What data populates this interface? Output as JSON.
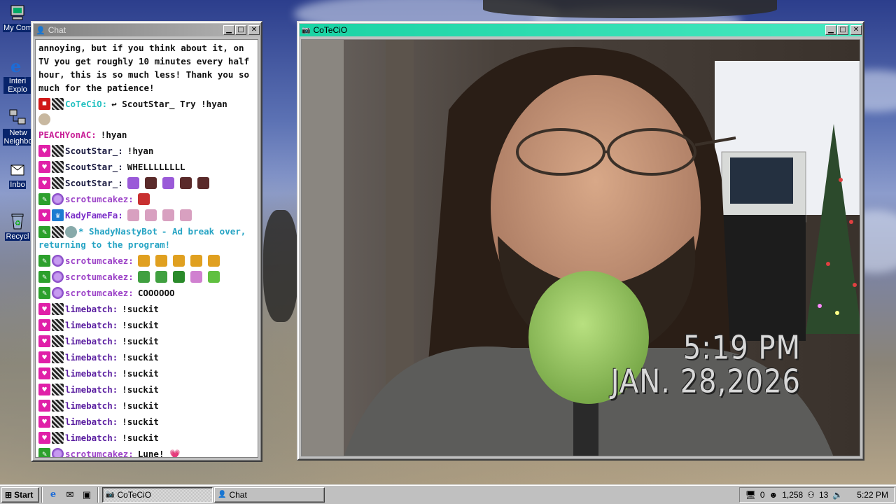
{
  "desktop": {
    "icons": [
      {
        "label": "My Com",
        "icon": "computer-icon"
      },
      {
        "label": "Interi Explo",
        "icon": "internet-explorer-icon"
      },
      {
        "label": "Netw Neighbo",
        "icon": "network-icon"
      },
      {
        "label": "Inbo",
        "icon": "inbox-icon"
      },
      {
        "label": "Recycl",
        "icon": "recycle-bin-icon"
      }
    ]
  },
  "chat_window": {
    "title": "Chat",
    "messages": [
      {
        "kind": "text",
        "text": "annoying, but if you think about it, on TV you get roughly 10 minutes every half hour, this is so much less! Thank you so much for the patience!"
      },
      {
        "kind": "msg",
        "badges": [
          "red",
          "grid"
        ],
        "user": "CoTeCiO:",
        "user_class": "n-coteci",
        "text": "↩ ScoutStar_ Try !hyan"
      },
      {
        "kind": "msg",
        "badges": [
          "face"
        ],
        "user": "",
        "user_class": "",
        "text": ""
      },
      {
        "kind": "msg",
        "badges": [],
        "user": "PEACHYonAC:",
        "user_class": "n-peach",
        "text": "!hyan"
      },
      {
        "kind": "msg",
        "badges": [
          "pink",
          "grid"
        ],
        "user": "ScoutStar_:",
        "user_class": "n-scout",
        "text": "!hyan"
      },
      {
        "kind": "msg",
        "badges": [
          "pink",
          "grid"
        ],
        "user": "ScoutStar_:",
        "user_class": "n-scout",
        "text": "WHELLLLLLLL"
      },
      {
        "kind": "msg",
        "badges": [
          "pink",
          "grid"
        ],
        "user": "ScoutStar_:",
        "user_class": "n-scout",
        "text": "",
        "emotes": [
          "#9a5ad8",
          "#5a2a2a",
          "#9a5ad8",
          "#5a2a2a",
          "#5a2a2a"
        ]
      },
      {
        "kind": "msg",
        "badges": [
          "green",
          "purple"
        ],
        "user": "scrotumcakez:",
        "user_class": "n-scrot",
        "text": "",
        "emotes": [
          "#c83030"
        ]
      },
      {
        "kind": "msg",
        "badges": [
          "pink",
          "crown"
        ],
        "user": "KadyFameFa:",
        "user_class": "n-kady",
        "text": "",
        "emotes": [
          "#d8a0c0",
          "#d8a0c0",
          "#d8a0c0",
          "#d8a0c0"
        ]
      },
      {
        "kind": "bot",
        "badges": [
          "green",
          "grid",
          "bot"
        ],
        "user": "* ShadyNastyBot",
        "user_class": "n-bot",
        "text": "- Ad break over, returning to the program!"
      },
      {
        "kind": "msg",
        "badges": [
          "green",
          "purple"
        ],
        "user": "scrotumcakez:",
        "user_class": "n-scrot",
        "text": "",
        "emotes": [
          "#e0a020",
          "#e0a020",
          "#e0a020",
          "#e0a020",
          "#e0a020"
        ]
      },
      {
        "kind": "msg",
        "badges": [
          "green",
          "purple"
        ],
        "user": "scrotumcakez:",
        "user_class": "n-scrot",
        "text": "",
        "emotes": [
          "#40a040",
          "#40a040",
          "#2a8a2a",
          "#d080d0",
          "#60c040"
        ]
      },
      {
        "kind": "msg",
        "badges": [
          "green",
          "purple"
        ],
        "user": "scrotumcakez:",
        "user_class": "n-scrot",
        "text": "COOOOOO"
      },
      {
        "kind": "msg",
        "badges": [
          "pink",
          "grid"
        ],
        "user": "limebatch:",
        "user_class": "n-lime",
        "text": "!suckit"
      },
      {
        "kind": "msg",
        "badges": [
          "pink",
          "grid"
        ],
        "user": "limebatch:",
        "user_class": "n-lime",
        "text": "!suckit"
      },
      {
        "kind": "msg",
        "badges": [
          "pink",
          "grid"
        ],
        "user": "limebatch:",
        "user_class": "n-lime",
        "text": "!suckit"
      },
      {
        "kind": "msg",
        "badges": [
          "pink",
          "grid"
        ],
        "user": "limebatch:",
        "user_class": "n-lime",
        "text": "!suckit"
      },
      {
        "kind": "msg",
        "badges": [
          "pink",
          "grid"
        ],
        "user": "limebatch:",
        "user_class": "n-lime",
        "text": "!suckit"
      },
      {
        "kind": "msg",
        "badges": [
          "pink",
          "grid"
        ],
        "user": "limebatch:",
        "user_class": "n-lime",
        "text": "!suckit"
      },
      {
        "kind": "msg",
        "badges": [
          "pink",
          "grid"
        ],
        "user": "limebatch:",
        "user_class": "n-lime",
        "text": "!suckit"
      },
      {
        "kind": "msg",
        "badges": [
          "pink",
          "grid"
        ],
        "user": "limebatch:",
        "user_class": "n-lime",
        "text": "!suckit"
      },
      {
        "kind": "msg",
        "badges": [
          "pink",
          "grid"
        ],
        "user": "limebatch:",
        "user_class": "n-lime",
        "text": "!suckit"
      },
      {
        "kind": "msg",
        "badges": [
          "green",
          "purple"
        ],
        "user": "scrotumcakez:",
        "user_class": "n-scrot",
        "text": "Lune! 💗"
      }
    ]
  },
  "camera_window": {
    "title": "CoTeCiO",
    "osd_time": "5:19 PM",
    "osd_date": "JAN. 28,2026"
  },
  "taskbar": {
    "start_label": "Start",
    "tasks": [
      {
        "label": "CoTeCiO",
        "active": true
      },
      {
        "label": "Chat",
        "active": false
      }
    ],
    "tray": {
      "count1": "0",
      "count2": "1,258",
      "count3": "13",
      "clock": "5:22 PM"
    }
  },
  "colors": {
    "chat_title_inactive": "#808080",
    "camera_title_active": "#1ad3a4",
    "desktop_icon_label_bg": "#08246b"
  }
}
